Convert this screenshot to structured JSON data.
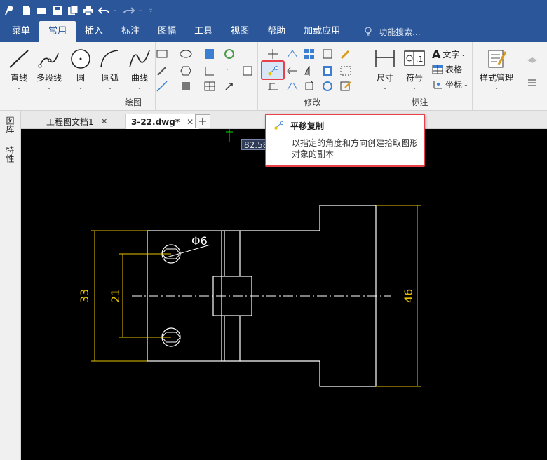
{
  "menu": {
    "tabs": [
      {
        "label": "菜单"
      },
      {
        "label": "常用"
      },
      {
        "label": "插入"
      },
      {
        "label": "标注"
      },
      {
        "label": "图幅"
      },
      {
        "label": "工具"
      },
      {
        "label": "视图"
      },
      {
        "label": "帮助"
      },
      {
        "label": "加载应用"
      }
    ],
    "active_tab": "常用",
    "search_placeholder": "功能搜索..."
  },
  "ribbon": {
    "draw": {
      "label": "绘图",
      "line": "直线",
      "polyline": "多段线",
      "circle": "圆",
      "arc": "圆弧",
      "curve": "曲线"
    },
    "modify": {
      "label": "修改"
    },
    "annotate": {
      "label": "标注",
      "dimension": "尺寸",
      "symbol": "符号",
      "text": "文字",
      "table": "表格",
      "coordinate": "坐标"
    },
    "style": {
      "manage": "样式管理"
    }
  },
  "leftrail": {
    "library": "图库",
    "properties": "特性"
  },
  "doctabs": {
    "tab1": "工程图文档1",
    "tab2": "3-22.dwg*"
  },
  "tooltip": {
    "title": "平移复制",
    "description": "以指定的角度和方向创建拾取图形对象的副本"
  },
  "canvas": {
    "coord_readout": "82.58",
    "dims": {
      "d33": "33",
      "d21": "21",
      "d46": "46",
      "phi6": "Φ6"
    }
  },
  "colors": {
    "brand": "#2b579a",
    "accent_red": "#e8414a",
    "dim_yellow": "#e6c200"
  }
}
